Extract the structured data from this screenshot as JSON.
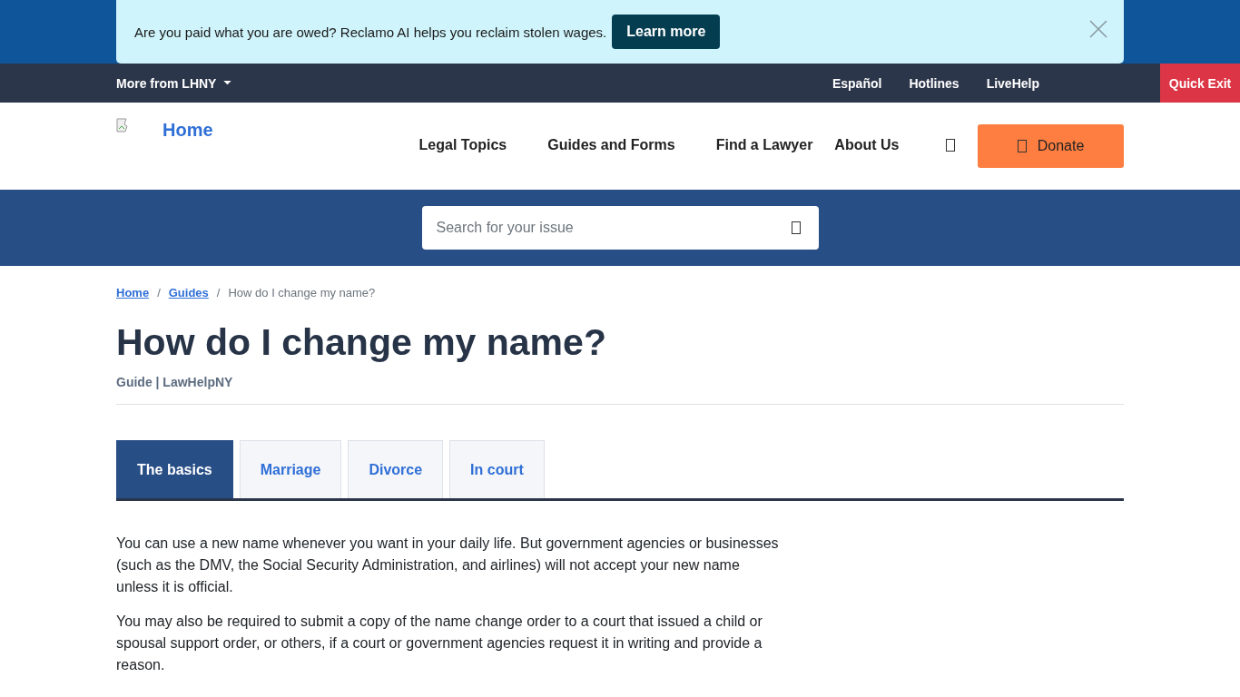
{
  "banner": {
    "text": "Are you paid what you are owed? Reclamo AI helps you reclaim stolen wages.",
    "button": "Learn more"
  },
  "utility_bar": {
    "menu": "More from LHNY",
    "links": [
      "Español",
      "Hotlines",
      "LiveHelp"
    ],
    "quick_exit": "Quick Exit"
  },
  "header": {
    "logo_alt": "Home",
    "nav": [
      "Legal Topics",
      "Guides and Forms",
      "Find a Lawyer",
      "About Us"
    ],
    "donate": "Donate"
  },
  "search": {
    "placeholder": "Search for your issue"
  },
  "breadcrumb_separator": "/",
  "breadcrumb": [
    {
      "label": "Home",
      "kind": "link"
    },
    {
      "label": "Guides",
      "kind": "link"
    },
    {
      "label": "How do I change my name?",
      "kind": "current"
    }
  ],
  "title": "How do I change my name?",
  "subtitle": "Guide | LawHelpNY",
  "tabs": [
    {
      "label": "The basics",
      "selected": true
    },
    {
      "label": "Marriage",
      "selected": false
    },
    {
      "label": "Divorce",
      "selected": false
    },
    {
      "label": "In court",
      "selected": false
    }
  ],
  "paragraphs": [
    "You can use a new name whenever you want in your daily life. But government agencies or businesses (such as the DMV, the Social Security Administration, and airlines) will not accept your new name unless it is official.",
    "You may also be required to submit a copy of the name change order to a court that issued a child or spousal support order, or others, if a court or government agencies request it in writing and provide a reason."
  ]
}
